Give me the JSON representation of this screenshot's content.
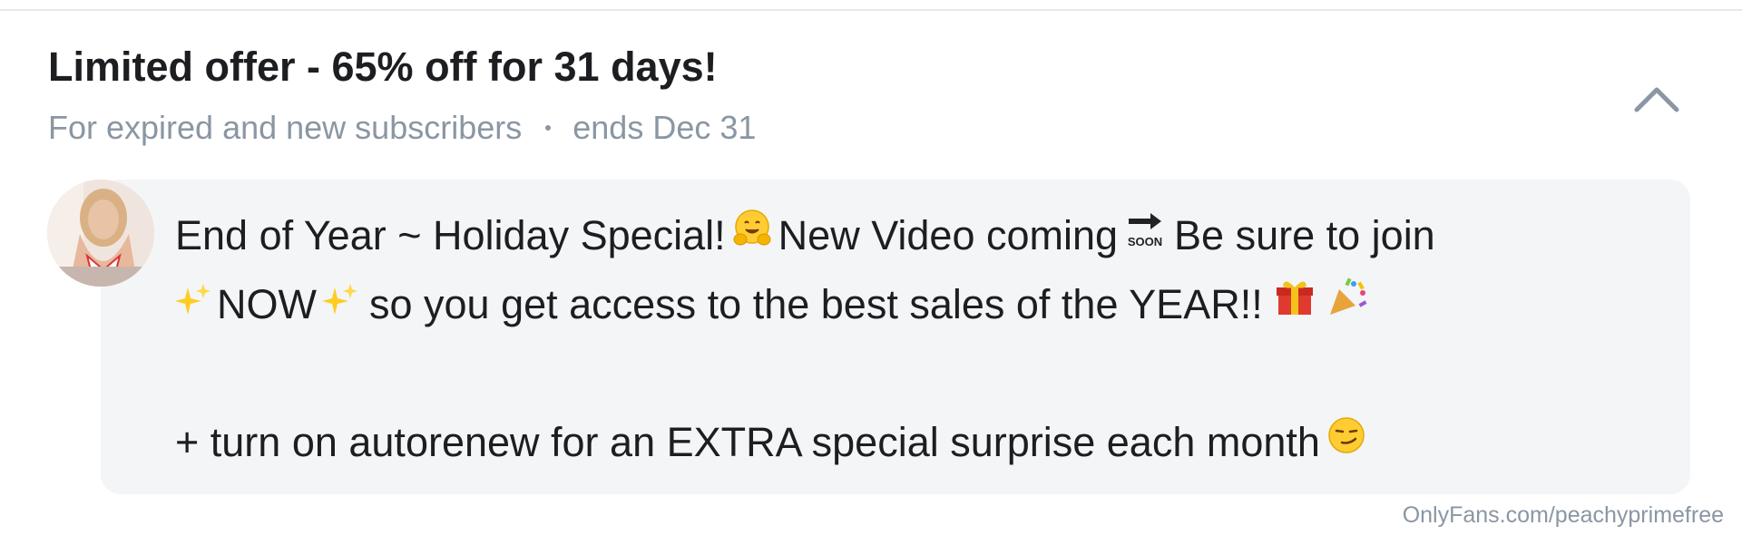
{
  "offer": {
    "title": "Limited offer - 65% off for 31 days!",
    "audience": "For expired and new subscribers",
    "ends": "ends Dec 31"
  },
  "message": {
    "line1": [
      "End of Year ~ Holiday Special!",
      "New Video coming",
      "Be sure to join"
    ],
    "line2": [
      "NOW",
      "so you get access to the best sales of the YEAR!!"
    ],
    "line3": [
      "+ turn on autorenew for an EXTRA special surprise each month"
    ],
    "soon_label": "SOON"
  },
  "icons": {
    "collapse": "chevron-up-icon",
    "hug": "hugging-face-icon",
    "soon": "soon-arrow-icon",
    "sparkles": "sparkles-icon",
    "gift": "wrapped-gift-icon",
    "party": "party-popper-icon",
    "smirk": "smirking-face-icon"
  },
  "watermark": "OnlyFans.com/peachyprimefree",
  "colors": {
    "title": "#1c1e21",
    "muted": "#8a96a3",
    "bubble": "#f3f5f7"
  }
}
